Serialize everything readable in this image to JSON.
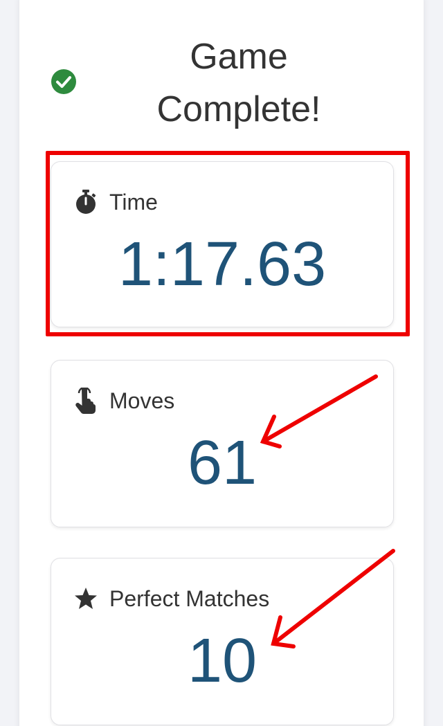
{
  "header": {
    "title": "Game Complete!",
    "status_icon": "check-circle-icon",
    "status_color": "#2e8b3e"
  },
  "stats": {
    "time": {
      "label": "Time",
      "value": "1:17.63",
      "icon": "stopwatch-icon"
    },
    "moves": {
      "label": "Moves",
      "value": "61",
      "icon": "tap-hand-icon"
    },
    "perfect_matches": {
      "label": "Perfect Matches",
      "value": "10",
      "icon": "star-icon"
    }
  },
  "colors": {
    "value_text": "#1f5378",
    "annotation": "#ee0000",
    "panel": "#ffffff",
    "background": "#f2f3f7"
  }
}
